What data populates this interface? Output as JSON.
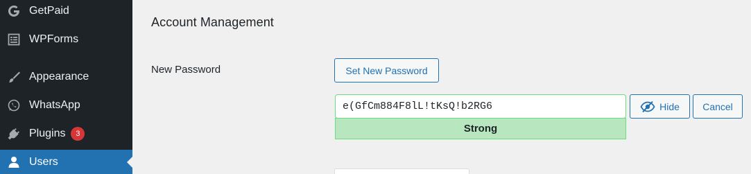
{
  "sidebar": {
    "items": [
      {
        "label": "GetPaid",
        "icon": "getpaid-icon"
      },
      {
        "label": "WPForms",
        "icon": "wpforms-icon"
      },
      {
        "label": "Appearance",
        "icon": "paintbrush-icon"
      },
      {
        "label": "WhatsApp",
        "icon": "whatsapp-icon"
      },
      {
        "label": "Plugins",
        "icon": "plugin-icon",
        "badge": "3"
      },
      {
        "label": "Users",
        "icon": "users-icon",
        "active": true
      }
    ],
    "colors": {
      "background": "#1d2327",
      "active": "#2271b1",
      "badge": "#d63638"
    }
  },
  "main": {
    "section_title": "Account Management",
    "new_password_label": "New Password",
    "set_new_password_button": "Set New Password",
    "password_value": "e(GfCm884F8lL!tKsQ!b2RG6",
    "strength_text": "Strong",
    "hide_button": "Hide",
    "cancel_button": "Cancel",
    "colors": {
      "accent": "#2271b1",
      "strength_bg": "#b8e6bf",
      "strength_border": "#68de7c"
    }
  }
}
